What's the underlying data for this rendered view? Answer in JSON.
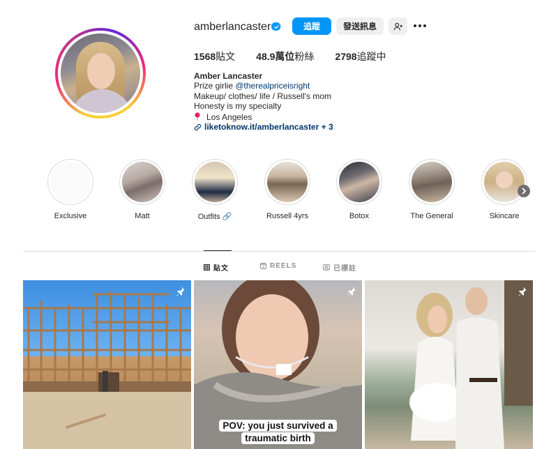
{
  "profile": {
    "username": "amberlancaster",
    "follow_label": "追蹤",
    "message_label": "發送訊息",
    "stats": {
      "posts_count": "1568",
      "posts_label": "貼文",
      "followers_count": "48.9萬位",
      "followers_label": "粉絲",
      "following_count": "2798",
      "following_label": "追蹤中"
    },
    "bio": {
      "name": "Amber Lancaster",
      "line1_prefix": "Prize girlie ",
      "line1_mention": "@therealpriceisright",
      "line2": "Makeup/ clothes/ life / Russell's mom",
      "line3": "Honesty is my specialty",
      "location": "Los Angeles",
      "link": "liketoknow.it/amberlancaster + 3"
    }
  },
  "highlights": [
    {
      "label": "Exclusive"
    },
    {
      "label": "Matt"
    },
    {
      "label": "Outfits 🔗"
    },
    {
      "label": "Russell 4yrs"
    },
    {
      "label": "Botox"
    },
    {
      "label": "The General"
    },
    {
      "label": "Skincare"
    }
  ],
  "tabs": [
    {
      "label": "貼文",
      "icon": "grid-icon",
      "active": true
    },
    {
      "label": "REELS",
      "icon": "reels-icon",
      "active": false
    },
    {
      "label": "已標註",
      "icon": "tagged-icon",
      "active": false
    }
  ],
  "posts": [
    {
      "pinned": true,
      "icon": "pin-icon"
    },
    {
      "pinned": true,
      "icon": "pin-icon",
      "caption_line1": "POV: you just survived a",
      "caption_line2": "traumatic birth"
    },
    {
      "pinned": true,
      "icon": "pin-icon"
    }
  ],
  "colors": {
    "accent": "#0095f6",
    "secondary_button": "#efefef",
    "link": "#00376b",
    "divider": "#dbdbdb"
  }
}
